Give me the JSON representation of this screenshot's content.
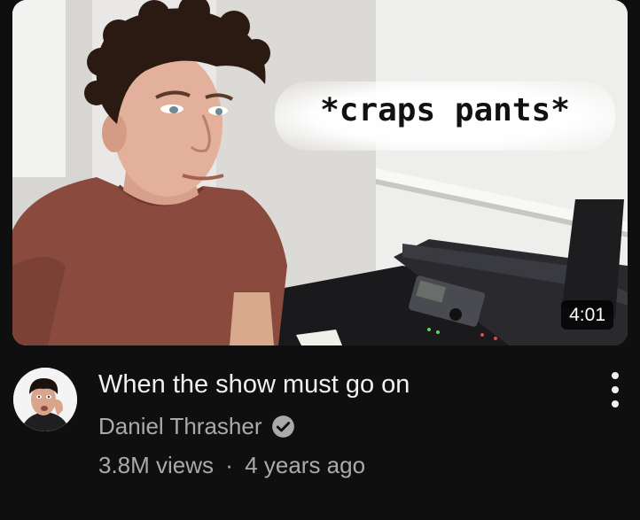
{
  "video": {
    "thumbnail_caption": "*craps pants*",
    "duration": "4:01",
    "title": "When the show must go on",
    "channel": {
      "name": "Daniel Thrasher",
      "verified": true
    },
    "views": "3.8M views",
    "separator": "·",
    "age": "4 years ago"
  },
  "icons": {
    "verified": "verified-check-icon",
    "more": "more-vertical-icon"
  },
  "colors": {
    "background": "#0f0f0f",
    "primary_text": "#f1f1f1",
    "secondary_text": "#aaaaaa",
    "shirt": "#8a4a3e"
  }
}
